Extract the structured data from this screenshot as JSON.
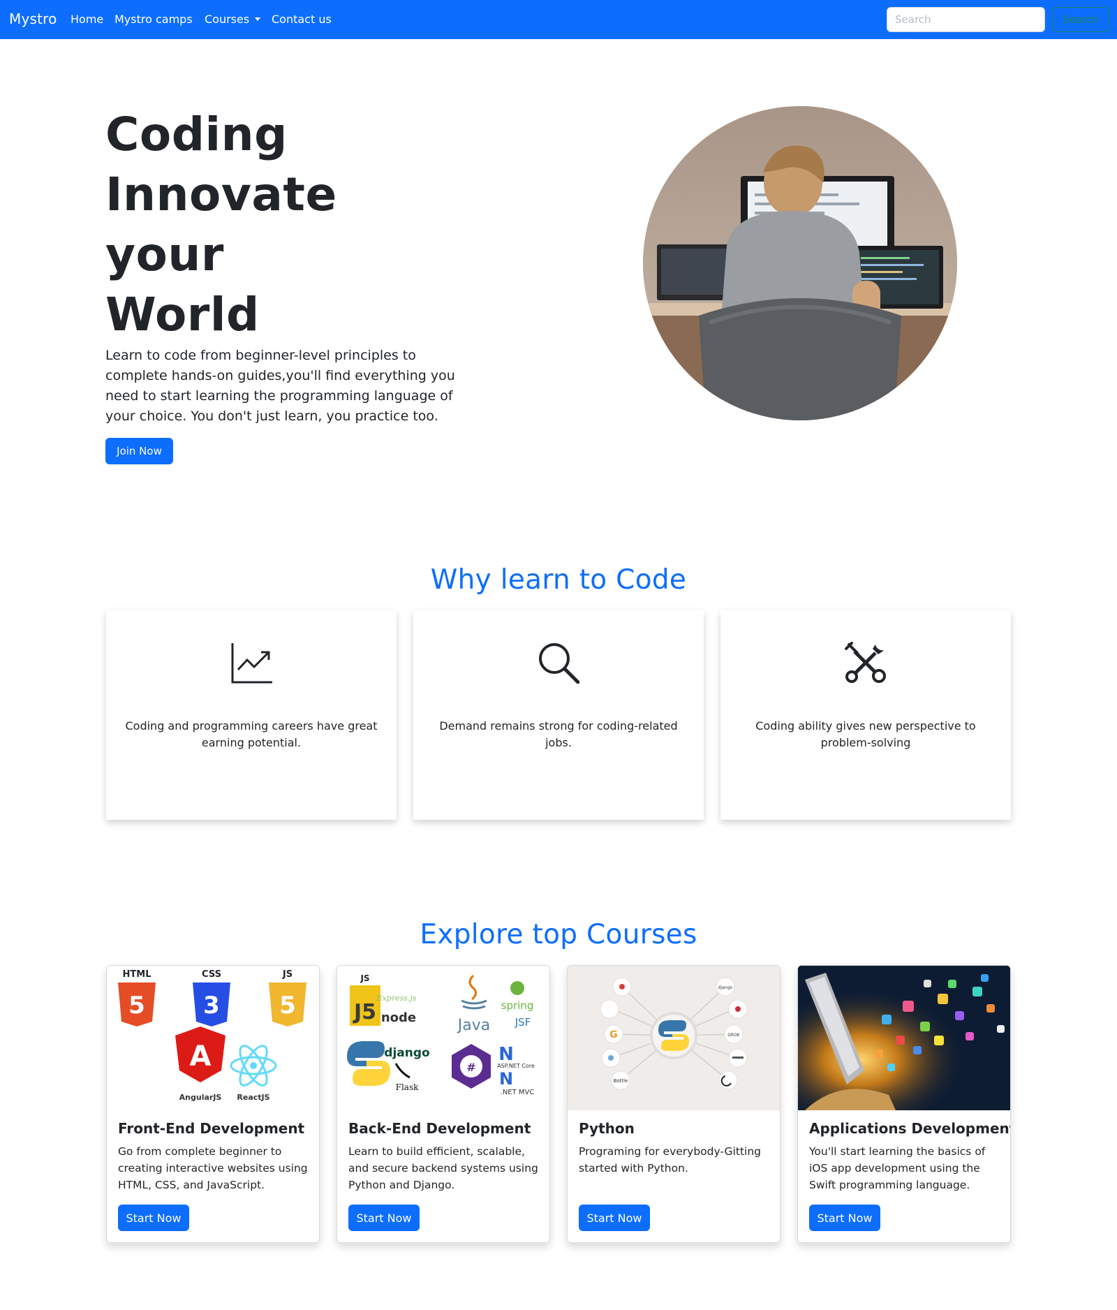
{
  "navbar": {
    "brand": "Mystro",
    "links": [
      "Home",
      "Mystro camps",
      "Courses",
      "Contact us"
    ],
    "search_placeholder": "Search",
    "search_button": "Search",
    "color": "#0d6efd"
  },
  "hero": {
    "title_lines": [
      "Coding",
      "Innovate",
      "your",
      "World"
    ],
    "description": "Learn to code from beginner-level principles to complete hands-on guides,you'll find everything you need to start learning the programming language of your choice. You don't just learn, you practice too.",
    "button": "Join Now"
  },
  "why": {
    "heading": "Why learn to Code",
    "cards": [
      {
        "icon": "chart-line-up-icon",
        "text": "Coding and programming careers have great earning potential."
      },
      {
        "icon": "search-icon",
        "text": "Demand remains strong for coding-related jobs."
      },
      {
        "icon": "tools-icon",
        "text": "Coding ability gives new perspective to problem-solving"
      }
    ]
  },
  "courses": {
    "heading": "Explore top Courses",
    "cards": [
      {
        "title": "Front-End Development",
        "text": "Go from complete beginner to creating interactive websites using HTML, CSS, and JavaScript.",
        "button": "Start Now",
        "logo_labels": [
          "HTML",
          "CSS",
          "JS",
          "AngularJS",
          "ReactJS"
        ]
      },
      {
        "title": "Back-End Development",
        "text": "Learn to build efficient, scalable, and secure backend systems using Python and Django.",
        "button": "Start Now",
        "logo_labels": [
          "JS",
          "Express.js",
          "node",
          "Java",
          "spring",
          "JSF",
          "django",
          "Flask",
          "ASP.NET Core",
          ".NET MVC"
        ]
      },
      {
        "title": "Python",
        "text": "Programing for everybody-Gitting started with Python.",
        "button": "Start Now",
        "logo_labels": [
          "django",
          "Bottle",
          "GROK"
        ]
      },
      {
        "title": "Applications Development",
        "text": "You'll start learning the basics of iOS app development using the Swift programming language.",
        "button": "Start Now",
        "logo_labels": []
      }
    ]
  }
}
